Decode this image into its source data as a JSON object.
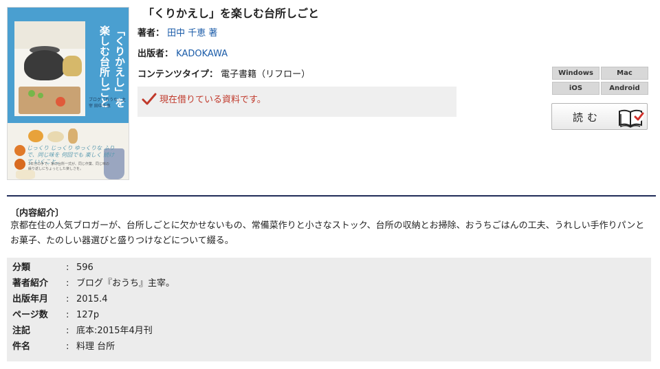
{
  "book": {
    "title": "「くりかえし」を楽しむ台所しごと",
    "author_label": "著者：",
    "author": "田中 千恵 著",
    "publisher_label": "出版者：",
    "publisher": "KADOKAWA",
    "content_type_label": "コンテンツタイプ：",
    "content_type": "電子書籍（リフロー）",
    "status_notice": "現在借りている資料です。"
  },
  "cover": {
    "title": "「くりかえし」を楽しむ台所しごと",
    "author_small": "ブログ『おうち』主宰 田中千恵",
    "handwriting": "じっくり じっくり ゆっくりな ふりで、同じ味を 何回でも 楽しく 続けて いくこと。",
    "small_text": "1年分の手で、家の台所一式が、同じ作業、同じ味の繰り返しにちょっとした楽しさを。"
  },
  "platforms": [
    "Windows",
    "Mac",
    "iOS",
    "Android"
  ],
  "read_button": {
    "label": "読む"
  },
  "intro": {
    "heading": "〔内容紹介〕",
    "text": "京都在住の人気ブロガーが、台所しごとに欠かせないもの、常備菜作りと小さなストック、台所の収納とお掃除、おうちごはんの工夫、うれしい手作りパンとお菓子、たのしい器選びと盛りつけなどについて綴る。"
  },
  "details": [
    {
      "label": "分類",
      "value": "596"
    },
    {
      "label": "著者紹介",
      "value": "ブログ『おうち』主宰。"
    },
    {
      "label": "出版年月",
      "value": "2015.4"
    },
    {
      "label": "ページ数",
      "value": "127p"
    },
    {
      "label": "注記",
      "value": "底本:2015年4月刊"
    },
    {
      "label": "件名",
      "value": "料理 台所"
    }
  ],
  "colors": {
    "link": "#1a5ba8",
    "notice_text": "#c0392b",
    "divider": "#1f2b58",
    "cover_blue": "#4a9fd0"
  },
  "icons": [
    "check-icon",
    "book-icon"
  ]
}
